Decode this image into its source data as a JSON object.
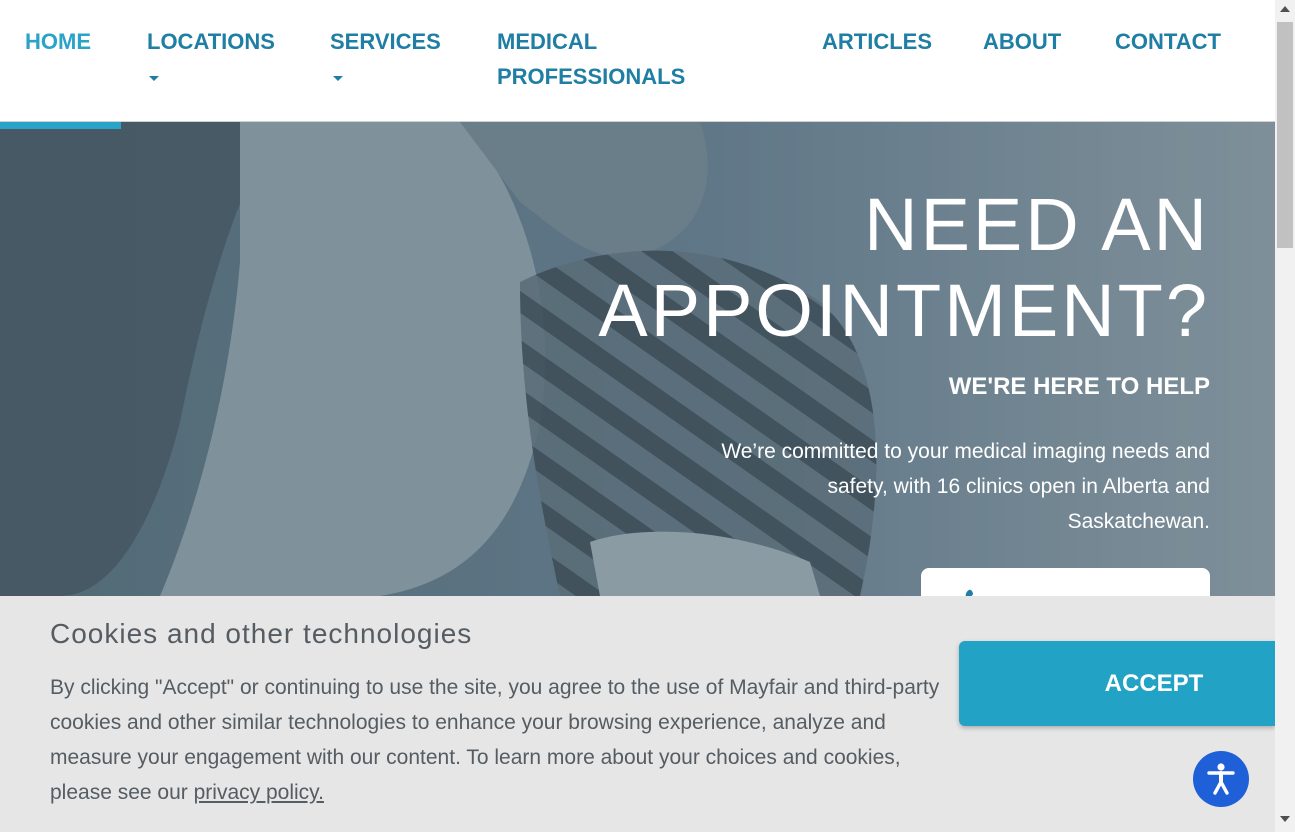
{
  "nav": {
    "home": "HOME",
    "locations": "LOCATIONS",
    "services": "SERVICES",
    "medical_1": "MEDICAL",
    "medical_2": "PROFESSIONALS",
    "articles": "ARTICLES",
    "about": "ABOUT",
    "contact": "CONTACT"
  },
  "hero": {
    "title_line1": "NEED AN",
    "title_line2": "APPOINTMENT?",
    "subtitle": "WE'RE HERE TO HELP",
    "body": "We’re committed to your medical imaging needs and safety, with 16 clinics open in Alberta and Saskatchewan.",
    "phone_icon": "phone-icon"
  },
  "cookie": {
    "title": "Cookies and other technologies",
    "text": "By clicking \"Accept\" or continuing to use the site, you agree to the use of Mayfair and third-party cookies and other similar technologies to enhance your browsing experience, analyze and measure your engagement with our content. To learn more about your choices and cookies, please see our ",
    "link": "privacy policy.",
    "accept": "ACCEPT"
  },
  "accessibility": {
    "icon": "accessibility-icon"
  },
  "colors": {
    "nav_text": "#1f7ea3",
    "nav_active": "#2aa3c8",
    "accept_bg": "#22a2c5",
    "a11y_bg": "#1f5fd8",
    "cookie_bg": "#e6e6e6"
  }
}
